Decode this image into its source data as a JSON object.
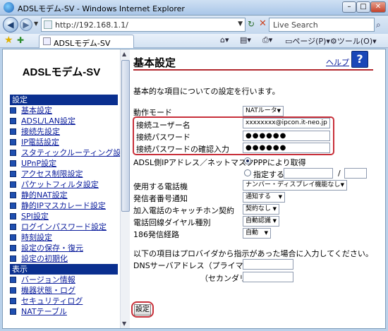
{
  "window": {
    "title": "ADSLモデム-SV - Windows Internet Explorer"
  },
  "browser": {
    "url": "http://192.168.1.1/",
    "search_placeholder": "Live Search",
    "tab_label": "ADSLモデム-SV",
    "toolbar": {
      "page": "ページ(P)",
      "tools": "ツール(O)"
    }
  },
  "sidebar": {
    "brand": "ADSLモデム-SV",
    "settings_header": "設定",
    "settings_items": [
      "基本設定",
      "ADSL/LAN設定",
      "接続先設定",
      "IP電話設定",
      "スタティックルーティング設定",
      "UPnP設定",
      "アクセス制限設定",
      "パケットフィルタ設定",
      "静的NAT設定",
      "静的IPマスカレード設定",
      "SPI設定",
      "ログインパスワード設定",
      "時刻設定",
      "設定の保存・復元",
      "設定の初期化"
    ],
    "display_header": "表示",
    "display_items": [
      "バージョン情報",
      "機器状態・ログ",
      "セキュリティログ",
      "NATテーブル"
    ]
  },
  "main": {
    "title": "基本設定",
    "help_label": "ヘルプ",
    "intro": "基本的な項目についての設定を行います。",
    "mode_label": "動作モード",
    "mode_value": "NATルータ",
    "username_label": "接続ユーザー名",
    "username_value": "xxxxxxxx@ipcon.it-neo.jp",
    "password_label": "接続パスワード",
    "password_value": "●●●●●●",
    "password_confirm_label": "接続パスワードの確認入力",
    "password_confirm_value": "●●●●●●",
    "ip_label": "ADSL側IPアドレス／ネットマスク",
    "ip_ppp": "PPPにより取得",
    "ip_specify": "指定する",
    "ip_separator": "/",
    "phone_label": "使用する電話機",
    "phone_value": "ナンバー・ディスプレイ機能なし",
    "callerid_label": "発信者番号通知",
    "callerid_value": "通知する",
    "catchphone_label": "加入電話のキャッチホン契約",
    "catchphone_value": "契約なし",
    "dialtype_label": "電話回線ダイヤル種別",
    "dialtype_value": "自動認識",
    "route186_label": "186発信経路",
    "route186_value": "自動",
    "provider_note": "以下の項目はプロバイダから指示があった場合に入力してください。",
    "dns_primary_label": "DNSサーバアドレス（プライマリ）",
    "dns_secondary_label": "（セカンダリ）",
    "submit_label": "設定"
  }
}
